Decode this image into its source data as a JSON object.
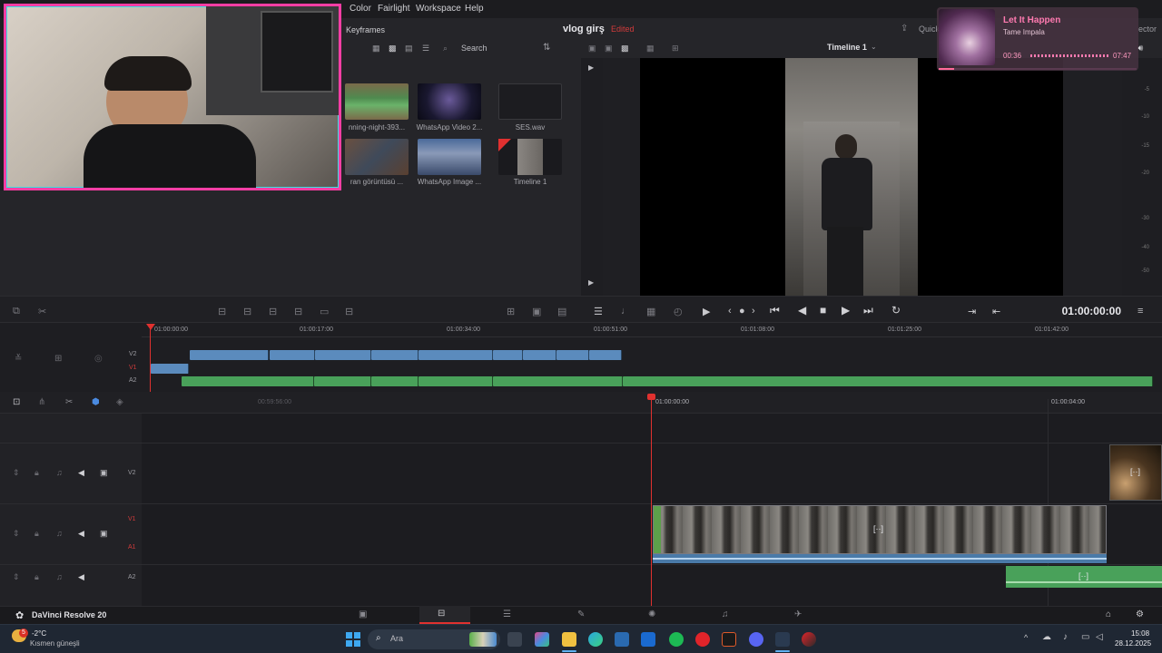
{
  "menu": {
    "items": [
      "Color",
      "Fairlight",
      "Workspace",
      "Help"
    ]
  },
  "media_pool": {
    "keyframes_label": "Keyframes",
    "search_placeholder": "Search",
    "project_title": "vlog girş",
    "edited_badge": "Edited",
    "clips": [
      {
        "label": "nning-night-393..."
      },
      {
        "label": "WhatsApp Video 2..."
      },
      {
        "label": "SES.wav"
      },
      {
        "label": "ran görüntüsü ..."
      },
      {
        "label": "WhatsApp Image ..."
      },
      {
        "label": "Timeline 1"
      }
    ]
  },
  "viewer": {
    "timeline_name": "Timeline 1",
    "quick_label": "Quick",
    "ector_label": "ector",
    "meter_ticks": [
      "-5",
      "-10",
      "-15",
      "-20",
      "-30",
      "-40",
      "-50"
    ]
  },
  "transport": {
    "timecode": "01:00:00:00"
  },
  "mini_timeline": {
    "ruler": [
      "01:00:00:00",
      "01:00:17:00",
      "01:00:34:00",
      "01:00:51:00",
      "01:01:08:00",
      "01:01:25:00",
      "01:01:42:00"
    ],
    "tracks": [
      "V2",
      "V1",
      "A2"
    ]
  },
  "lower_timeline": {
    "ruler": [
      "00:59:56:00",
      "01:00:00:00",
      "01:00:04:00"
    ],
    "tracks": [
      {
        "name": "V2"
      },
      {
        "name": "V1",
        "sub": "A1"
      },
      {
        "name": "A2"
      }
    ],
    "clip_badge": "[··]"
  },
  "appbar": {
    "app_name": "DaVinci Resolve 20"
  },
  "music": {
    "title": "Let It Happen",
    "artist": "Tame Impala",
    "elapsed": "00:36",
    "total": "07:47",
    "progress": 0.077
  },
  "taskbar": {
    "weather_temp": "-2°C",
    "weather_desc": "Kısmen güneşli",
    "weather_badge": "5",
    "search_placeholder": "Ara",
    "time": "15:08",
    "date": "28.12.2025"
  },
  "colors": {
    "accent_pink": "#ff3ea5",
    "clip_blue": "#5b8bbd",
    "clip_green": "#49a15a",
    "playhead": "#e0312f"
  }
}
